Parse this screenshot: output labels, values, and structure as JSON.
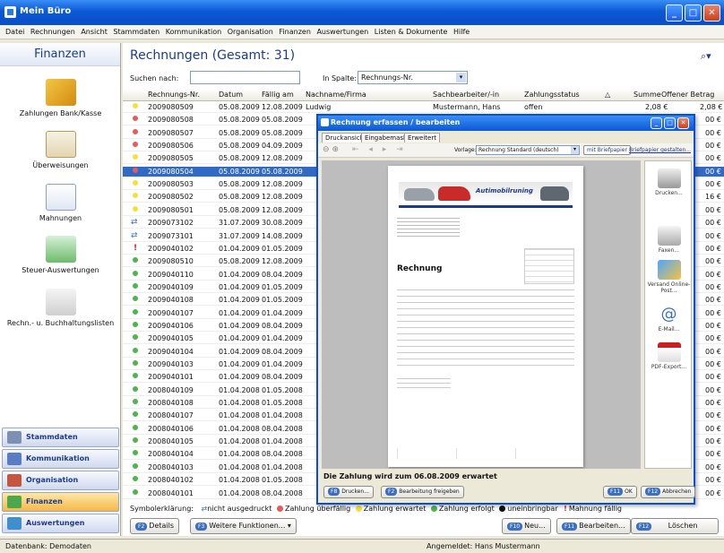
{
  "window": {
    "title": "Mein Büro"
  },
  "menu": [
    "Datei",
    "Rechnungen",
    "Ansicht",
    "Stammdaten",
    "Kommunikation",
    "Organisation",
    "Finanzen",
    "Auswertungen",
    "Listen & Dokumente",
    "Hilfe"
  ],
  "sidebar": {
    "title": "Finanzen",
    "items": [
      "Zahlungen Bank/Kasse",
      "Überweisungen",
      "Mahnungen",
      "Steuer-Auswertungen",
      "Rechn.- u. Buchhaltungslisten"
    ],
    "nav": [
      "Stammdaten",
      "Kommunikation",
      "Organisation",
      "Finanzen",
      "Auswertungen"
    ]
  },
  "main": {
    "title": "Rechnungen (Gesamt: 31)",
    "search_label": "Suchen nach:",
    "column_label": "In Spalte:",
    "column_value": "Rechnungs-Nr.",
    "headers": [
      "Rechnungs-Nr.",
      "Datum",
      "Fällig am",
      "Nachname/Firma",
      "Sachbearbeiter/-in",
      "Zahlungsstatus",
      "Summe",
      "Offener Betrag"
    ],
    "first_row_extra": {
      "name": "Ludwig",
      "agent": "Mustermann, Hans",
      "status": "offen",
      "sum": "2,08 €",
      "open": "2,08 €"
    },
    "rows": [
      {
        "nr": "2009080509",
        "datum": "05.08.2009",
        "faellig": "12.08.2009",
        "s": "yellow",
        "open": ""
      },
      {
        "nr": "2009080508",
        "datum": "05.08.2009",
        "faellig": "05.08.2009",
        "s": "red",
        "open": "00 €"
      },
      {
        "nr": "2009080507",
        "datum": "05.08.2009",
        "faellig": "05.08.2009",
        "s": "red",
        "open": "00 €"
      },
      {
        "nr": "2009080506",
        "datum": "05.08.2009",
        "faellig": "04.09.2009",
        "s": "red",
        "open": "00 €"
      },
      {
        "nr": "2009080505",
        "datum": "05.08.2009",
        "faellig": "12.08.2009",
        "s": "yellow",
        "open": "00 €"
      },
      {
        "nr": "2009080504",
        "datum": "05.08.2009",
        "faellig": "05.08.2009",
        "s": "red",
        "open": "00 €"
      },
      {
        "nr": "2009080503",
        "datum": "05.08.2009",
        "faellig": "12.08.2009",
        "s": "yellow",
        "open": "00 €"
      },
      {
        "nr": "2009080502",
        "datum": "05.08.2009",
        "faellig": "12.08.2009",
        "s": "yellow",
        "open": "16 €"
      },
      {
        "nr": "2009080501",
        "datum": "05.08.2009",
        "faellig": "12.08.2009",
        "s": "yellow",
        "open": "00 €"
      },
      {
        "nr": "2009073102",
        "datum": "31.07.2009",
        "faellig": "30.08.2009",
        "s": "arrow",
        "open": "00 €"
      },
      {
        "nr": "2009073101",
        "datum": "31.07.2009",
        "faellig": "14.08.2009",
        "s": "arrow",
        "open": "00 €"
      },
      {
        "nr": "2009040102",
        "datum": "01.04.2009",
        "faellig": "01.05.2009",
        "s": "excl",
        "open": "00 €"
      },
      {
        "nr": "2009080510",
        "datum": "05.08.2009",
        "faellig": "12.08.2009",
        "s": "green",
        "open": "00 €"
      },
      {
        "nr": "2009040110",
        "datum": "01.04.2009",
        "faellig": "08.04.2009",
        "s": "green",
        "open": "00 €"
      },
      {
        "nr": "2009040109",
        "datum": "01.04.2009",
        "faellig": "01.05.2009",
        "s": "green",
        "open": "00 €"
      },
      {
        "nr": "2009040108",
        "datum": "01.04.2009",
        "faellig": "01.05.2009",
        "s": "green",
        "open": "00 €"
      },
      {
        "nr": "2009040107",
        "datum": "01.04.2009",
        "faellig": "01.04.2009",
        "s": "green",
        "open": "00 €"
      },
      {
        "nr": "2009040106",
        "datum": "01.04.2009",
        "faellig": "08.04.2009",
        "s": "green",
        "open": "00 €"
      },
      {
        "nr": "2009040105",
        "datum": "01.04.2009",
        "faellig": "01.04.2009",
        "s": "green",
        "open": "00 €"
      },
      {
        "nr": "2009040104",
        "datum": "01.04.2009",
        "faellig": "08.04.2009",
        "s": "green",
        "open": "00 €"
      },
      {
        "nr": "2009040103",
        "datum": "01.04.2009",
        "faellig": "01.04.2009",
        "s": "green",
        "open": "00 €"
      },
      {
        "nr": "2009040101",
        "datum": "01.04.2009",
        "faellig": "08.04.2009",
        "s": "green",
        "open": "00 €"
      },
      {
        "nr": "2008040109",
        "datum": "01.04.2008",
        "faellig": "01.05.2008",
        "s": "green",
        "open": "00 €"
      },
      {
        "nr": "2008040108",
        "datum": "01.04.2008",
        "faellig": "01.05.2008",
        "s": "green",
        "open": "00 €"
      },
      {
        "nr": "2008040107",
        "datum": "01.04.2008",
        "faellig": "01.04.2008",
        "s": "green",
        "open": "00 €"
      },
      {
        "nr": "2008040106",
        "datum": "01.04.2008",
        "faellig": "08.04.2008",
        "s": "green",
        "open": "00 €"
      },
      {
        "nr": "2008040105",
        "datum": "01.04.2008",
        "faellig": "01.04.2008",
        "s": "green",
        "open": "00 €"
      },
      {
        "nr": "2008040104",
        "datum": "01.04.2008",
        "faellig": "08.04.2008",
        "s": "green",
        "open": "00 €"
      },
      {
        "nr": "2008040103",
        "datum": "01.04.2008",
        "faellig": "01.04.2008",
        "s": "green",
        "open": "00 €"
      },
      {
        "nr": "2008040102",
        "datum": "01.04.2008",
        "faellig": "01.05.2008",
        "s": "green",
        "open": "00 €"
      },
      {
        "nr": "2008040101",
        "datum": "01.04.2008",
        "faellig": "08.04.2008",
        "s": "green",
        "open": "00 €"
      }
    ],
    "selected_index": 5,
    "legend": {
      "label": "Symbolerklärung:",
      "items": [
        "nicht ausgedruckt",
        "Zahlung überfällig",
        "Zahlung erwartet",
        "Zahlung erfolgt",
        "uneinbringbar",
        "Mahnung fällig"
      ]
    },
    "buttons": {
      "details_key": "F2",
      "details": "Details",
      "more_key": "F3",
      "more": "Weitere Funktionen... ▾",
      "new_key": "F10",
      "new": "Neu...",
      "edit_key": "F11",
      "edit": "Bearbeiten...",
      "del_key": "F12",
      "del": "Löschen"
    }
  },
  "dialog": {
    "title": "Rechnung erfassen / bearbeiten",
    "tabs": [
      "Druckansicht",
      "Eingabemaske",
      "Erweitert"
    ],
    "template_label": "Vorlage:",
    "template_value": "Rechnung Standard (deutsch)",
    "letterhead": "mit Briefpapier",
    "letterhead_link": "Briefpapier gestalten...",
    "doc_heading": "Rechnung",
    "company_logo": "Autimobilruning",
    "side": [
      "Drucken...",
      "Faxen...",
      "Versand Online-Post...",
      "E-Mail...",
      "PDF-Export..."
    ],
    "payment_note": "Die Zahlung wird zum 06.08.2009 erwartet",
    "btn_print_key": "F8",
    "btn_print": "Drucken...",
    "btn_release_key": "F2",
    "btn_release": "Bearbeitung freigeben",
    "btn_ok_key": "F11",
    "btn_ok": "OK",
    "btn_cancel_key": "F12",
    "btn_cancel": "Abbrechen"
  },
  "status": {
    "db": "Datenbank: Demodaten",
    "user": "Angemeldet: Hans Mustermann"
  },
  "colors": {
    "red": "#e35d5d",
    "yellow": "#f3e13a",
    "green": "#4fb34f",
    "accent": "#1d3b8c",
    "selected": "#316ac5"
  }
}
